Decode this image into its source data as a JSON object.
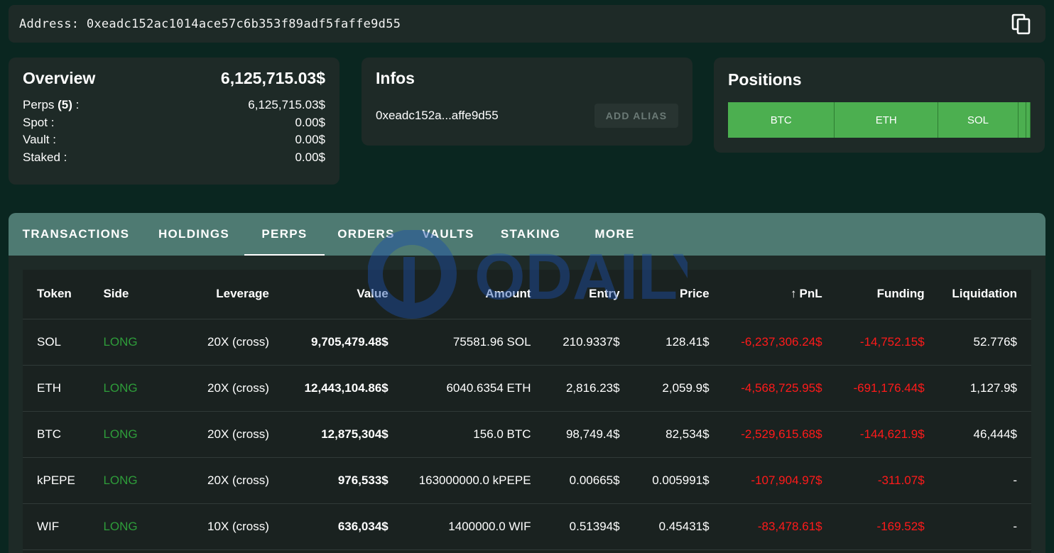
{
  "address_bar": {
    "label": "Address: 0xeadc152ac1014ace57c6b353f89adf5faffe9d55",
    "copy_icon": "copy-icon"
  },
  "overview": {
    "title": "Overview",
    "total": "6,125,715.03$",
    "rows": [
      {
        "label_pre": "Perps ",
        "label_bold": "(5)",
        "label_post": " :",
        "value": "6,125,715.03$"
      },
      {
        "label_pre": "Spot :",
        "label_bold": "",
        "label_post": "",
        "value": "0.00$"
      },
      {
        "label_pre": "Vault :",
        "label_bold": "",
        "label_post": "",
        "value": "0.00$"
      },
      {
        "label_pre": "Staked :",
        "label_bold": "",
        "label_post": "",
        "value": "0.00$"
      }
    ]
  },
  "infos": {
    "title": "Infos",
    "short_address": "0xeadc152a...affe9d55",
    "add_alias_label": "ADD ALIAS"
  },
  "positions": {
    "title": "Positions",
    "bars": [
      {
        "label": "BTC",
        "share": 0.353
      },
      {
        "label": "ETH",
        "share": 0.342
      },
      {
        "label": "SOL",
        "share": 0.265
      },
      {
        "label": "",
        "share": 0.027
      },
      {
        "label": "",
        "share": 0.013
      }
    ]
  },
  "tabs": [
    {
      "label": "TRANSACTIONS",
      "active": false
    },
    {
      "label": "HOLDINGS",
      "active": false
    },
    {
      "label": "PERPS",
      "active": true
    },
    {
      "label": "ORDERS",
      "active": false
    },
    {
      "label": "VAULTS",
      "active": false
    },
    {
      "label": "STAKING",
      "active": false
    },
    {
      "label": "MORE",
      "active": false
    }
  ],
  "table": {
    "headers": [
      "Token",
      "Side",
      "Leverage",
      "Value",
      "Amount",
      "Entry",
      "Price",
      "PnL",
      "Funding",
      "Liquidation"
    ],
    "sort_icon": "arrow-up-icon",
    "rows": [
      [
        "SOL",
        "LONG",
        "20X (cross)",
        "9,705,479.48$",
        "75581.96 SOL",
        "210.9337$",
        "128.41$",
        "-6,237,306.24$",
        "-14,752.15$",
        "52.776$"
      ],
      [
        "ETH",
        "LONG",
        "20X (cross)",
        "12,443,104.86$",
        "6040.6354 ETH",
        "2,816.23$",
        "2,059.9$",
        "-4,568,725.95$",
        "-691,176.44$",
        "1,127.9$"
      ],
      [
        "BTC",
        "LONG",
        "20X (cross)",
        "12,875,304$",
        "156.0 BTC",
        "98,749.4$",
        "82,534$",
        "-2,529,615.68$",
        "-144,621.9$",
        "46,444$"
      ],
      [
        "kPEPE",
        "LONG",
        "20X (cross)",
        "976,533$",
        "163000000.0 kPEPE",
        "0.00665$",
        "0.005991$",
        "-107,904.97$",
        "-311.07$",
        "-"
      ],
      [
        "WIF",
        "LONG",
        "10X (cross)",
        "636,034$",
        "1400000.0 WIF",
        "0.51394$",
        "0.45431$",
        "-83,478.61$",
        "-169.52$",
        "-"
      ]
    ]
  },
  "watermark": {
    "text": "ODAILY"
  }
}
